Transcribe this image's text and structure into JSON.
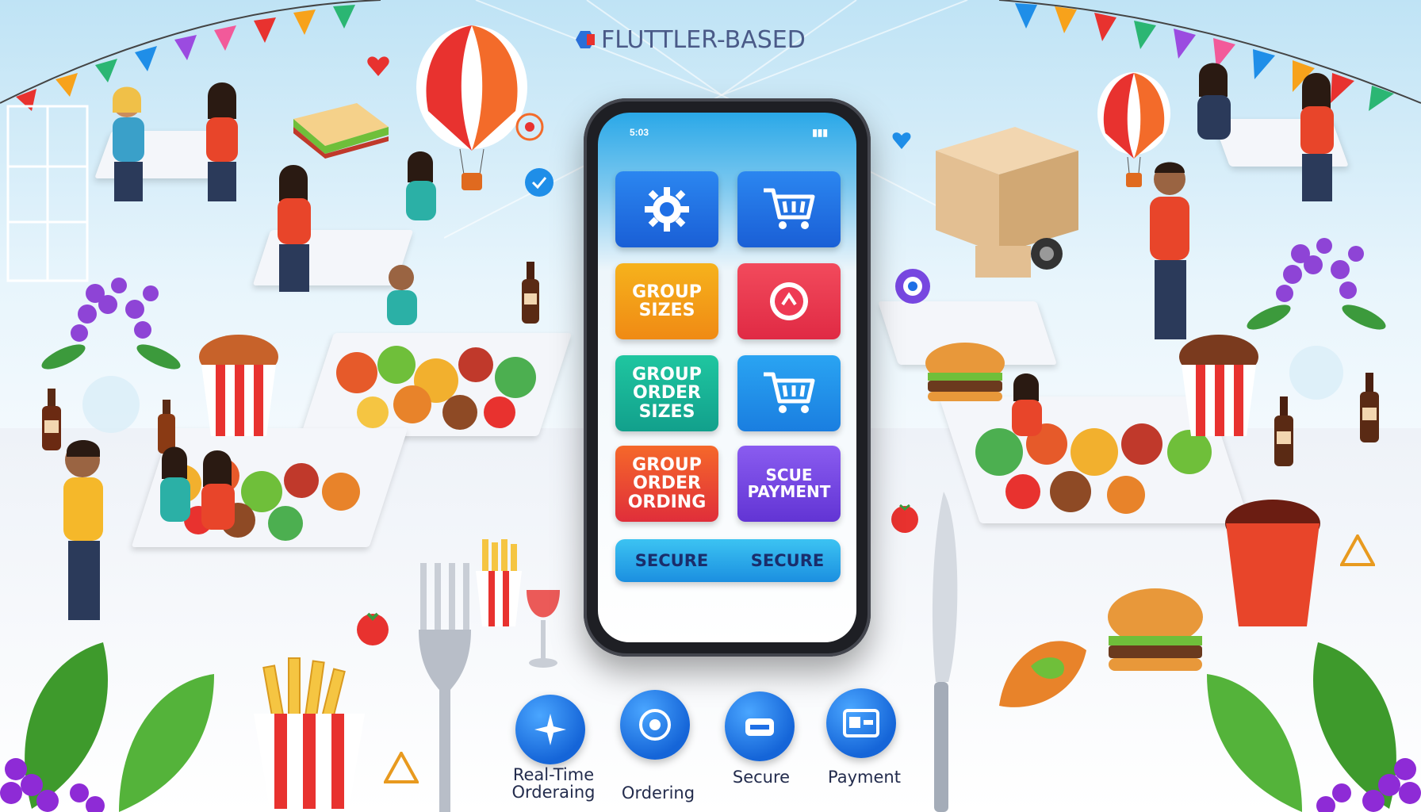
{
  "header": {
    "brand": "FLUTTLER-BASED"
  },
  "phone": {
    "status_left": "5:03",
    "status_right": "▮▮▮",
    "tiles": [
      {
        "id": "settings",
        "label": "",
        "icon": "gear-icon",
        "color": "#1f6fe5"
      },
      {
        "id": "cart",
        "label": "",
        "icon": "cart-icon",
        "color": "#1f6fe5"
      },
      {
        "id": "group-sizes",
        "label": "GROUP\nSIZES",
        "icon": "",
        "color": "#f39b12"
      },
      {
        "id": "location",
        "label": "",
        "icon": "location-pin-icon",
        "color": "#ee3a54"
      },
      {
        "id": "group-order-sizes",
        "label": "GROUP\nORDER\nSIZES",
        "icon": "",
        "color": "#16b59a"
      },
      {
        "id": "cart-2",
        "label": "",
        "icon": "cart-icon",
        "color": "#1c8ee8"
      },
      {
        "id": "group-order-ordring",
        "label": "GROUP\nORDER\nORDING",
        "icon": "",
        "color": "#ee4a3a"
      },
      {
        "id": "scue-payment",
        "label": "SCUE\nPAYMENT",
        "icon": "",
        "color": "#7747e0"
      }
    ],
    "pills": [
      "SECURE",
      "SECURE"
    ]
  },
  "features": [
    {
      "id": "realtime",
      "label": "Real-Time\nOrderaing",
      "icon": "sparkle-icon"
    },
    {
      "id": "ordering",
      "label": "Ordering",
      "icon": "target-icon"
    },
    {
      "id": "secure",
      "label": "Secure",
      "icon": "shield-icon"
    },
    {
      "id": "payment",
      "label": "Payment",
      "icon": "card-icon"
    }
  ],
  "colors": {
    "accent": "#1f6fe5",
    "pennants": [
      "#e8322f",
      "#f7a21b",
      "#2bb673",
      "#1f8ee8",
      "#9b4be0",
      "#f25a9a"
    ]
  }
}
